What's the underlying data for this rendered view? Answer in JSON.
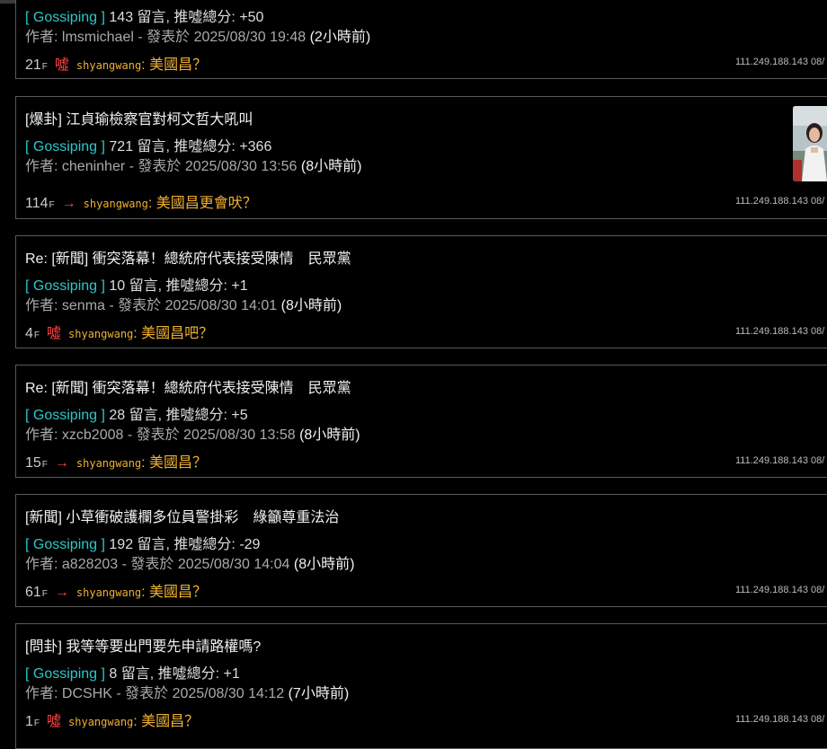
{
  "posts": [
    {
      "title": "",
      "board": "[ Gossiping ]",
      "stats": "143 留言, 推噓總分: +50",
      "author": "作者: lmsmichael - 發表於 2025/08/30 19:48",
      "ago": "(2小時前)",
      "floor": "21",
      "floor_suffix": "F",
      "tag": "噓",
      "tag_type": "boo",
      "user": "shyangwang",
      "content": "美國昌？",
      "ip": "111.249.188.143 08/"
    },
    {
      "title": "[爆卦] 江貞瑜檢察官對柯文哲大吼叫",
      "board": "[ Gossiping ]",
      "stats": "721 留言, 推噓總分: +366",
      "author": "作者: cheninher - 發表於 2025/08/30 13:56",
      "ago": "(8小時前)",
      "floor": "114",
      "floor_suffix": "F",
      "tag": "→",
      "tag_type": "arrow",
      "user": "shyangwang",
      "content": "美國昌更會吠？",
      "ip": "111.249.188.143 08/"
    },
    {
      "title": "Re: [新聞] 衝突落幕！總統府代表接受陳情　民眾黨",
      "board": "[ Gossiping ]",
      "stats": "10 留言, 推噓總分: +1",
      "author": "作者: senma - 發表於 2025/08/30 14:01",
      "ago": "(8小時前)",
      "floor": "4",
      "floor_suffix": "F",
      "tag": "噓",
      "tag_type": "boo",
      "user": "shyangwang",
      "content": "美國昌吧？",
      "ip": "111.249.188.143 08/"
    },
    {
      "title": "Re: [新聞] 衝突落幕！總統府代表接受陳情　民眾黨",
      "board": "[ Gossiping ]",
      "stats": "28 留言, 推噓總分: +5",
      "author": "作者: xzcb2008 - 發表於 2025/08/30 13:58",
      "ago": "(8小時前)",
      "floor": "15",
      "floor_suffix": "F",
      "tag": "→",
      "tag_type": "arrow",
      "user": "shyangwang",
      "content": "美國昌？",
      "ip": "111.249.188.143 08/"
    },
    {
      "title": "[新聞] 小草衝破護欄多位員警掛彩　綠籲尊重法治",
      "board": "[ Gossiping ]",
      "stats": "192 留言, 推噓總分: -29",
      "author": "作者: a828203 - 發表於 2025/08/30 14:04",
      "ago": "(8小時前)",
      "floor": "61",
      "floor_suffix": "F",
      "tag": "→",
      "tag_type": "arrow",
      "user": "shyangwang",
      "content": "美國昌？",
      "ip": "111.249.188.143 08/"
    },
    {
      "title": "[問卦] 我等等要出門要先申請路權嗎?",
      "board": "[ Gossiping ]",
      "stats": "8 留言, 推噓總分: +1",
      "author": "作者: DCSHK - 發表於 2025/08/30 14:12",
      "ago": "(7小時前)",
      "floor": "1",
      "floor_suffix": "F",
      "tag": "噓",
      "tag_type": "boo",
      "user": "shyangwang",
      "content": "美國昌？",
      "ip": "111.249.188.143 08/"
    }
  ]
}
